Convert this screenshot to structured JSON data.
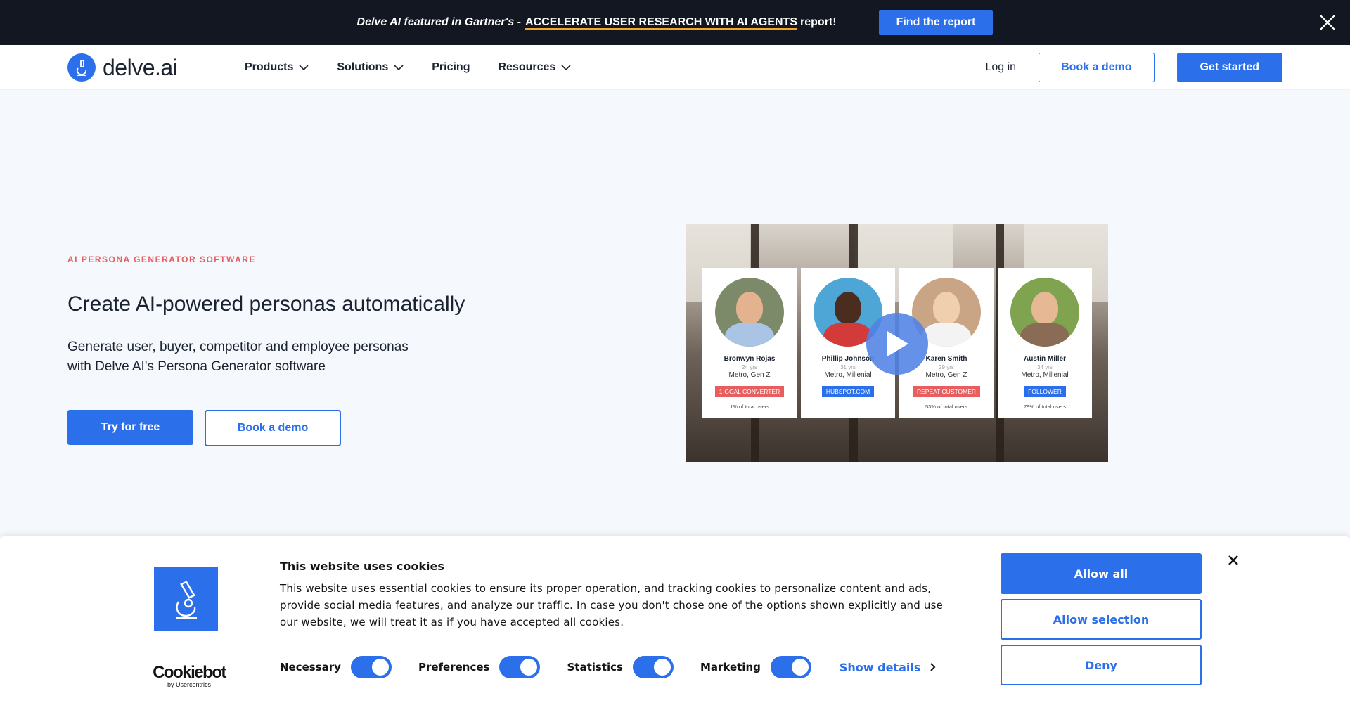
{
  "announcement": {
    "lead": "Delve AI featured in Gartner's -",
    "highlight": "ACCELERATE USER RESEARCH WITH AI AGENTS",
    "tail": "report!",
    "button": "Find the report"
  },
  "nav": {
    "logo_text": "delve.ai",
    "links": [
      {
        "label": "Products",
        "dropdown": true
      },
      {
        "label": "Solutions",
        "dropdown": true
      },
      {
        "label": "Pricing",
        "dropdown": false
      },
      {
        "label": "Resources",
        "dropdown": true
      }
    ],
    "login": "Log in",
    "book_demo": "Book a demo",
    "get_started": "Get started"
  },
  "hero": {
    "eyebrow": "AI PERSONA GENERATOR SOFTWARE",
    "title": "Create AI-powered personas automatically",
    "subtitle_line1": "Generate user, buyer, competitor and employee personas",
    "subtitle_line2": "with Delve AI's Persona Generator software",
    "try_button": "Try for free",
    "demo_button": "Book a demo"
  },
  "video": {
    "personas": [
      {
        "name": "Bronwyn Rojas",
        "age": "24 yrs",
        "segment": "Metro, Gen Z",
        "tag": "1-GOAL CONVERTER",
        "tag_color": "#e85d5d",
        "share": "1% of total users"
      },
      {
        "name": "Phillip Johnson",
        "age": "31 yrs",
        "segment": "Metro, Millenial",
        "tag": "HUBSPOT.COM",
        "tag_color": "#2b6fea",
        "share": ""
      },
      {
        "name": "Karen Smith",
        "age": "29 yrs",
        "segment": "Metro, Gen Z",
        "tag": "REPEAT CUSTOMER",
        "tag_color": "#e85d5d",
        "share": "53% of total users"
      },
      {
        "name": "Austin Miller",
        "age": "34 yrs",
        "segment": "Metro, Millenial",
        "tag": "FOLLOWER",
        "tag_color": "#2b6fea",
        "share": "79% of total users"
      }
    ]
  },
  "cookie": {
    "brand": "Cookiebot",
    "brand_sub": "by Usercentrics",
    "title": "This website uses cookies",
    "text": "This website uses essential cookies to ensure its proper operation, and tracking cookies to personalize content and ads, provide social media features, and analyze our traffic. In case you don't chose one of the options shown explicitly and use our website, we will treat it as if you have accepted all cookies.",
    "toggles": [
      {
        "label": "Necessary",
        "on": true
      },
      {
        "label": "Preferences",
        "on": true
      },
      {
        "label": "Statistics",
        "on": true
      },
      {
        "label": "Marketing",
        "on": true
      }
    ],
    "show_details": "Show details",
    "allow_all": "Allow all",
    "allow_selection": "Allow selection",
    "deny": "Deny"
  },
  "colors": {
    "brand_blue": "#2b6fea",
    "announce_bg": "#131722",
    "eyebrow_red": "#e85d5d"
  }
}
